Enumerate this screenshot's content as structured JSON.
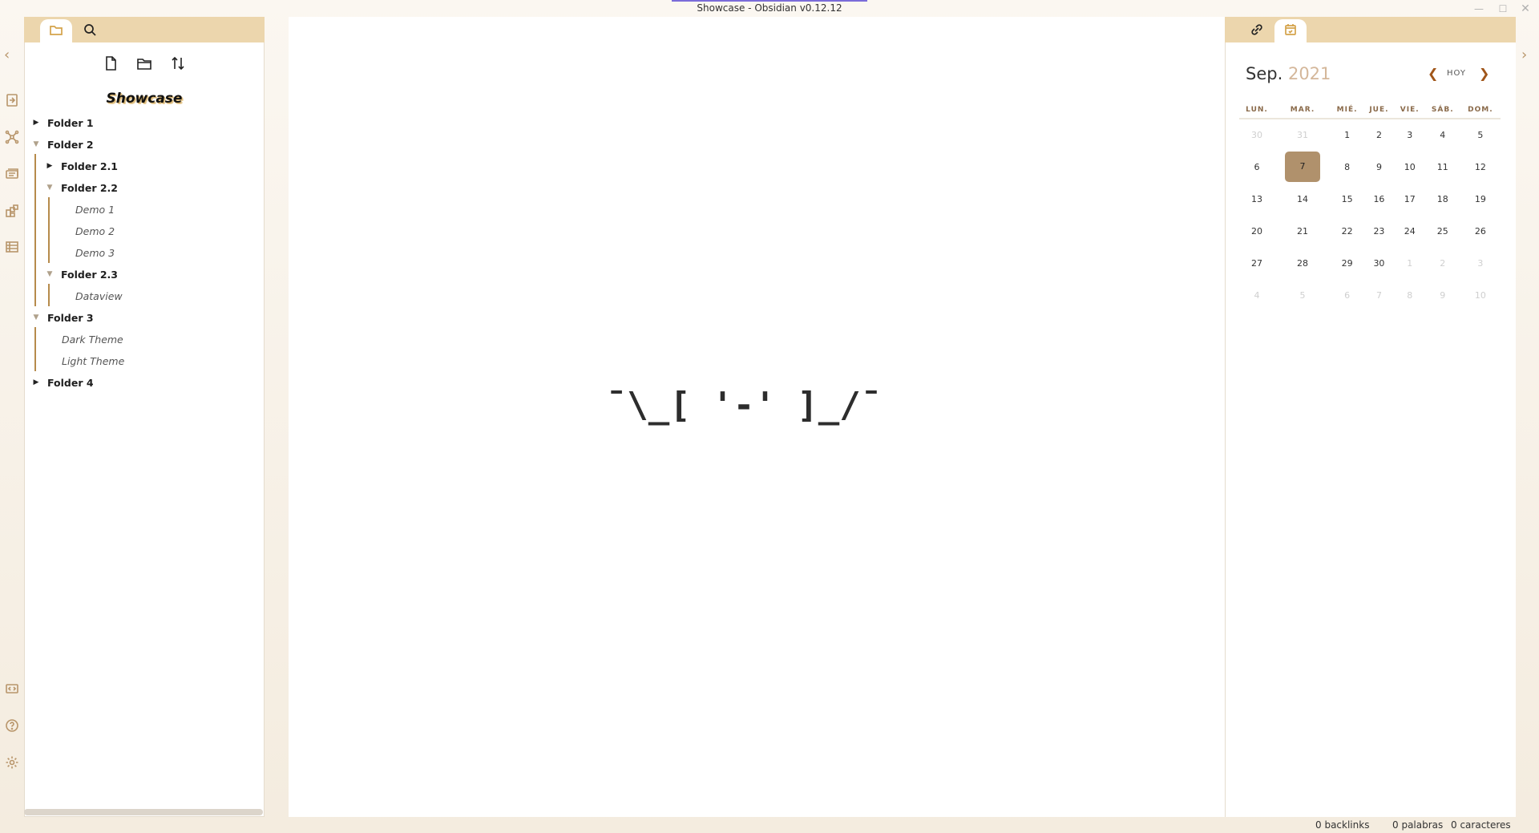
{
  "window": {
    "title": "Showcase - Obsidian v0.12.12",
    "controls": [
      "minimize",
      "maximize",
      "close"
    ]
  },
  "ribbon": {
    "icons": [
      "open-switcher-icon",
      "graph-view-icon",
      "open-templates-icon",
      "outline-icon",
      "table-icon",
      "vault-switch-icon",
      "help-icon",
      "settings-icon"
    ]
  },
  "left_sidebar": {
    "tabs": [
      "file-explorer",
      "search"
    ],
    "nav_actions": [
      "new-note",
      "new-folder",
      "change-sort-order"
    ],
    "vault_name": "Showcase",
    "tree": {
      "folder1": "Folder 1",
      "folder2": "Folder 2",
      "folder2_1": "Folder 2.1",
      "folder2_2": "Folder 2.2",
      "demo1": "Demo 1",
      "demo2": "Demo 2",
      "demo3": "Demo 3",
      "folder2_3": "Folder 2.3",
      "dataview": "Dataview",
      "folder3": "Folder 3",
      "dark_theme": "Dark Theme",
      "light_theme": "Light Theme",
      "folder4": "Folder 4"
    }
  },
  "editor": {
    "empty_state": "¯\\_[ '-' ]_/¯"
  },
  "right_sidebar": {
    "tabs": [
      "backlinks",
      "calendar"
    ],
    "calendar": {
      "month": "Sep.",
      "year": "2021",
      "today_label": "HOY",
      "weekdays": [
        "LUN.",
        "MAR.",
        "MIÉ.",
        "JUE.",
        "VIE.",
        "SÁB.",
        "DOM."
      ],
      "weeks": [
        [
          "30",
          "31",
          "1",
          "2",
          "3",
          "4",
          "5"
        ],
        [
          "6",
          "7",
          "8",
          "9",
          "10",
          "11",
          "12"
        ],
        [
          "13",
          "14",
          "15",
          "16",
          "17",
          "18",
          "19"
        ],
        [
          "20",
          "21",
          "22",
          "23",
          "24",
          "25",
          "26"
        ],
        [
          "27",
          "28",
          "29",
          "30",
          "1",
          "2",
          "3"
        ],
        [
          "4",
          "5",
          "6",
          "7",
          "8",
          "9",
          "10"
        ]
      ],
      "muted": [
        [
          0,
          0
        ],
        [
          0,
          1
        ],
        [
          4,
          4
        ],
        [
          4,
          5
        ],
        [
          4,
          6
        ],
        [
          5,
          0
        ],
        [
          5,
          1
        ],
        [
          5,
          2
        ],
        [
          5,
          3
        ],
        [
          5,
          4
        ],
        [
          5,
          5
        ],
        [
          5,
          6
        ]
      ],
      "selected": [
        1,
        1
      ],
      "selected_color": "#b0916c"
    }
  },
  "status_bar": {
    "backlinks": "0 backlinks",
    "words": "0 palabras",
    "chars": "0 caracteres"
  },
  "colors": {
    "accent": "#ecd6ad",
    "guide": "#b68b4c",
    "icon": "#b8956a"
  }
}
